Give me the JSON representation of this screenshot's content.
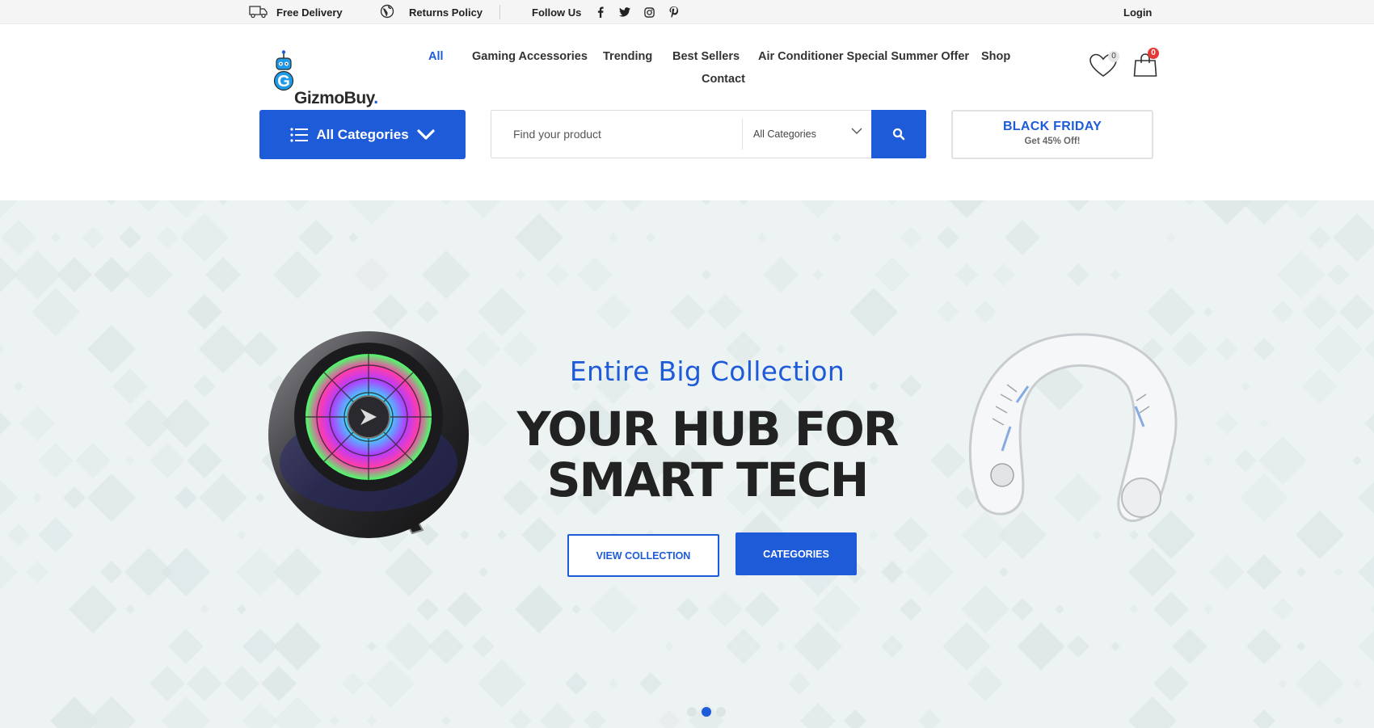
{
  "topbar": {
    "delivery": "Free Delivery",
    "returns": "Returns Policy",
    "follow": "Follow Us",
    "login": "Login",
    "social_icons": [
      "facebook-icon",
      "twitter-icon",
      "instagram-icon",
      "pinterest-icon"
    ]
  },
  "logo": {
    "text": "GizmoBuy",
    "dot": "."
  },
  "nav": {
    "items": [
      "All",
      "Gaming Accessories",
      "Trending",
      "Best Sellers",
      "Air Conditioner Special Summer Offer",
      "Shop",
      "Contact"
    ],
    "active": "All"
  },
  "wishlist": {
    "count": "0"
  },
  "cart": {
    "count": "0"
  },
  "all_categories_label": "All Categories",
  "search": {
    "placeholder": "Find your product",
    "category_selected": "All Categories"
  },
  "promo": {
    "title": "BLACK FRIDAY",
    "subtitle": "Get 45% Off!"
  },
  "hero": {
    "subtitle": "Entire Big Collection",
    "headline_line1": "YOUR HUB FOR",
    "headline_line2": "SMART TECH",
    "btn_view": "VIEW COLLECTION",
    "btn_categories": "CATEGORIES",
    "slides_total": 3,
    "slide_active": 2
  },
  "colors": {
    "accent": "#1e5bd8",
    "badge_red": "#e53935",
    "hero_bg": "#edf3f3",
    "topbar_bg": "#f5f5f5"
  }
}
